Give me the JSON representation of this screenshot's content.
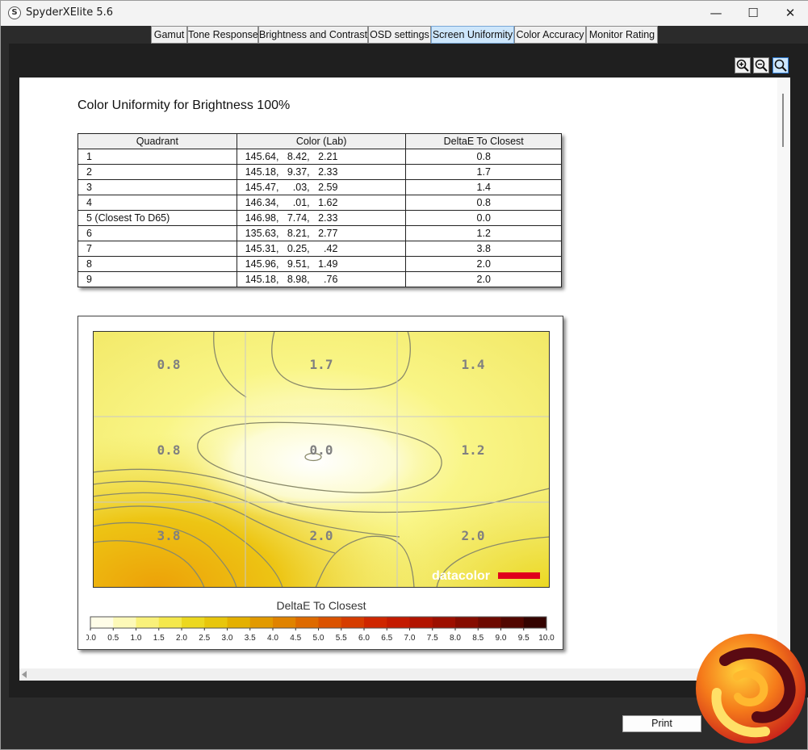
{
  "window": {
    "title": "SpyderXElite 5.6",
    "minimize_glyph": "—",
    "maximize_glyph": "☐",
    "close_glyph": "✕"
  },
  "tabs": [
    {
      "label": "Gamut",
      "active": false
    },
    {
      "label": "Tone Response",
      "active": false
    },
    {
      "label": "Brightness and Contrast",
      "active": false
    },
    {
      "label": "OSD settings",
      "active": false
    },
    {
      "label": "Screen Uniformity",
      "active": true
    },
    {
      "label": "Color Accuracy",
      "active": false
    },
    {
      "label": "Monitor Rating",
      "active": false
    }
  ],
  "toolbar": {
    "icons": [
      "zoom-in-icon",
      "zoom-out-icon",
      "zoom-fit-icon"
    ]
  },
  "report": {
    "title": "Color Uniformity for Brightness 100%",
    "table": {
      "headers": [
        "Quadrant",
        "Color (Lab)",
        "DeltaE To Closest"
      ],
      "rows": [
        {
          "quadrant": "1",
          "lab": "145.64,   8.42,   2.21",
          "delta": "0.8"
        },
        {
          "quadrant": "2",
          "lab": "145.18,   9.37,   2.33",
          "delta": "1.7"
        },
        {
          "quadrant": "3",
          "lab": "145.47,     .03,   2.59",
          "delta": "1.4"
        },
        {
          "quadrant": "4",
          "lab": "146.34,     .01,   1.62",
          "delta": "0.8"
        },
        {
          "quadrant": "5 (Closest To D65)",
          "lab": "146.98,   7.74,   2.33",
          "delta": "0.0"
        },
        {
          "quadrant": "6",
          "lab": "135.63,   8.21,   2.77",
          "delta": "1.2"
        },
        {
          "quadrant": "7",
          "lab": "145.31,   0.25,     .42",
          "delta": "3.8"
        },
        {
          "quadrant": "8",
          "lab": "145.96,   9.51,   1.49",
          "delta": "2.0"
        },
        {
          "quadrant": "9",
          "lab": "145.18,   8.98,     .76",
          "delta": "2.0"
        }
      ]
    },
    "uniformity_map": {
      "grid_values": [
        [
          "0.8",
          "1.7",
          "1.4"
        ],
        [
          "0.8",
          "0.0",
          "1.2"
        ],
        [
          "3.8",
          "2.0",
          "2.0"
        ]
      ],
      "brand": "datacolor",
      "brand_bar_color": "#e0001b"
    },
    "legend": {
      "title": "DeltaE To Closest",
      "ticks": [
        "0.0",
        "0.5",
        "1.0",
        "1.5",
        "2.0",
        "2.5",
        "3.0",
        "3.5",
        "4.0",
        "4.5",
        "5.0",
        "5.5",
        "6.0",
        "6.5",
        "7.0",
        "7.5",
        "8.0",
        "8.5",
        "9.0",
        "9.5",
        "10.0"
      ],
      "colors": [
        "#fffde8",
        "#fdf9b8",
        "#f9f17a",
        "#f4e84c",
        "#ecd820",
        "#e8c60c",
        "#e4b000",
        "#e29a00",
        "#e08300",
        "#de6a00",
        "#db5200",
        "#d63c00",
        "#cf2600",
        "#c41a00",
        "#b21300",
        "#9d0f00",
        "#860c00",
        "#6d0900",
        "#520600",
        "#340300"
      ]
    }
  },
  "footer": {
    "print_label": "Print"
  }
}
